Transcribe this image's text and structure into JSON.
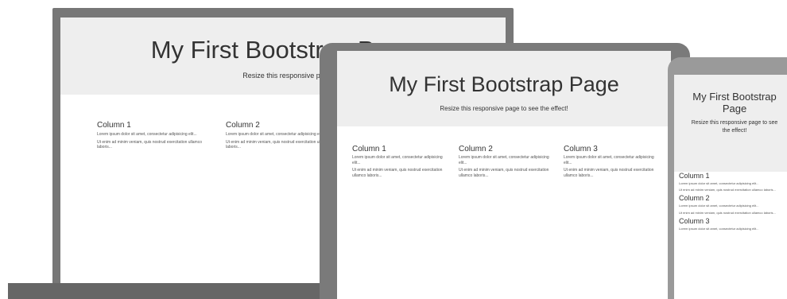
{
  "page": {
    "title": "My First Bootstrap Page",
    "subtitle": "Resize this responsive page to see the effect!"
  },
  "laptop": {
    "title": "My First Bootstrap Page",
    "subtitle": "Resize this responsive page to see the effect!"
  },
  "tablet": {
    "title": "My First Bootstrap Page",
    "subtitle": "Resize this responsive page to see the effect!"
  },
  "phone": {
    "title_line1": "My First Bootstrap",
    "title_line2": "Page",
    "subtitle_line1": "Resize this responsive page to see",
    "subtitle_line2": "the effect!"
  },
  "columns": [
    {
      "heading": "Column 1",
      "text1": "Lorem ipsum dolor sit amet, consectetur adipisicing elit...",
      "text2": "Ut enim ad minim veniam, quis nostrud exercitation ullamco laboris..."
    },
    {
      "heading": "Column 2",
      "text1": "Lorem ipsum dolor sit amet, consectetur adipisicing elit...",
      "text2": "Ut enim ad minim veniam, quis nostrud exercitation ullamco laboris..."
    },
    {
      "heading": "Column 3",
      "text1": "Lorem ipsum dolor sit amet, consectetur adipisicing elit...",
      "text2": "Ut enim ad minim veniam, quis nostrud exercitation ullamco laboris..."
    }
  ],
  "colors": {
    "device_frame": "#777777",
    "jumbotron": "#eeeeee",
    "text": "#333333"
  }
}
